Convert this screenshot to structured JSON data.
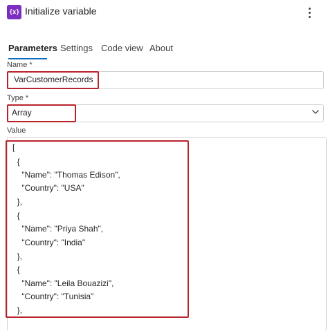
{
  "header": {
    "icon_glyph": "{x}",
    "icon_name": "variable-icon",
    "title": "Initialize variable",
    "more_icon": "more-vertical-icon"
  },
  "tabs": [
    {
      "label": "Parameters",
      "active": true
    },
    {
      "label": "Settings",
      "active": false
    },
    {
      "label": "Code view",
      "active": false
    },
    {
      "label": "About",
      "active": false
    }
  ],
  "name_field": {
    "label": "Name *",
    "value": "VarCustomerRecords"
  },
  "type_field": {
    "label": "Type *",
    "value": "Array",
    "icon": "chevron-down-icon"
  },
  "value_field": {
    "label": "Value",
    "lines": [
      "[",
      "  {",
      "    \"Name\": \"Thomas Edison\",",
      "    \"Country\": \"USA\"",
      "  },",
      "  {",
      "    \"Name\": \"Priya Shah\",",
      "    \"Country\": \"India\"",
      "  },",
      "  {",
      "    \"Name\": \"Leila Bouazizi\",",
      "    \"Country\": \"Tunisia\"",
      "  },"
    ]
  },
  "colors": {
    "accent": "#0f6cbd",
    "highlight": "#b8222a",
    "icon_bg": "#7b2ec0"
  }
}
